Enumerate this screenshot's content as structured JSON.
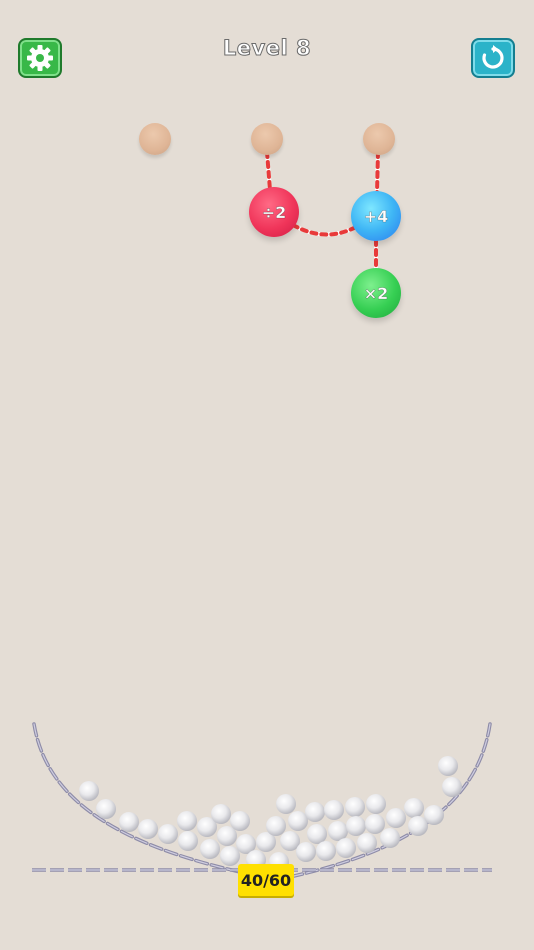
{
  "header": {
    "title": "Level 8"
  },
  "controls": {
    "settings_icon": "gear-icon",
    "restart_icon": "restart-icon"
  },
  "operators": {
    "divide": "÷2",
    "add": "+4",
    "multiply": "×2"
  },
  "counter": {
    "text": "40/60",
    "collected": 40,
    "target": 60
  },
  "colors": {
    "background": "#e4ddd5",
    "settings_button": "#38b848",
    "restart_button": "#2bb3c9",
    "divide_orb": "#f0355a",
    "add_orb": "#3fb6f5",
    "multiply_orb": "#36cf53",
    "counter_badge": "#ffe000",
    "rope": "#e83a3a",
    "chain": "#8e8ca8"
  }
}
